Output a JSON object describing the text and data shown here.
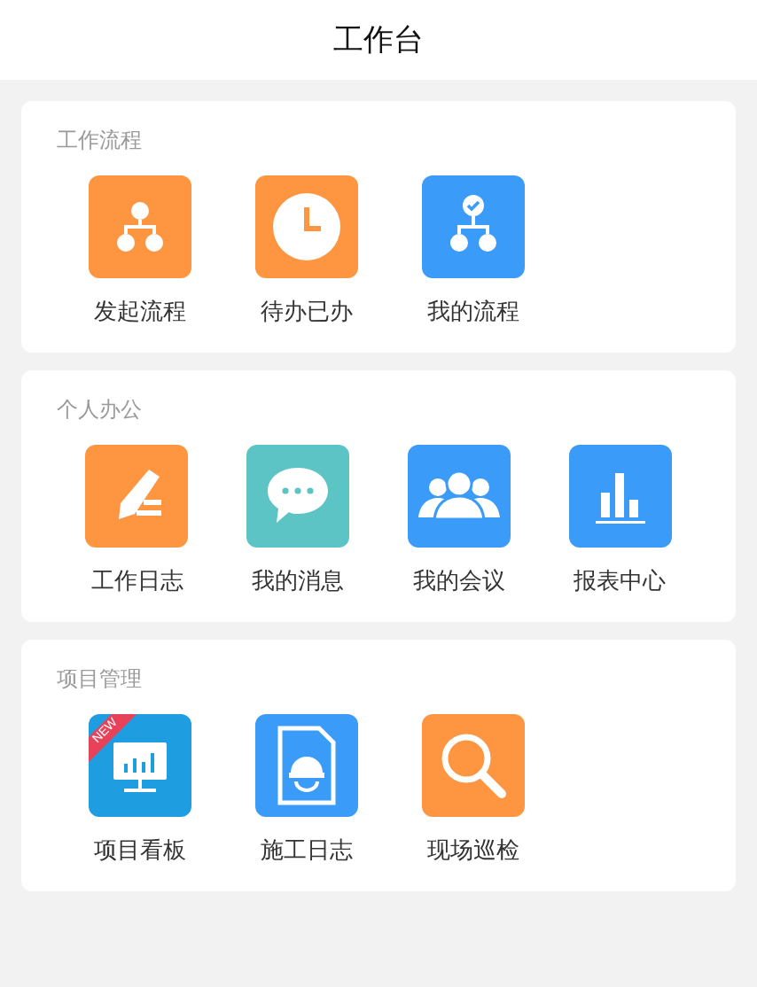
{
  "header": {
    "title": "工作台"
  },
  "sections": [
    {
      "title": "工作流程",
      "items": [
        {
          "label": "发起流程",
          "kind": "flow",
          "color": "#fe9540"
        },
        {
          "label": "待办已办",
          "kind": "clock",
          "color": "#fe9540"
        },
        {
          "label": "我的流程",
          "kind": "flowcheck",
          "color": "#3a9bf8"
        }
      ]
    },
    {
      "title": "个人办公",
      "items": [
        {
          "label": "工作日志",
          "kind": "pencil",
          "color": "#fe9540"
        },
        {
          "label": "我的消息",
          "kind": "chat",
          "color": "#5cc4c4"
        },
        {
          "label": "我的会议",
          "kind": "people",
          "color": "#3a9bf8"
        },
        {
          "label": "报表中心",
          "kind": "bars",
          "color": "#3a9bf8"
        }
      ]
    },
    {
      "title": "项目管理",
      "items": [
        {
          "label": "项目看板",
          "kind": "monitor",
          "color": "#1e9ee0",
          "badge": "NEW"
        },
        {
          "label": "施工日志",
          "kind": "helmetdoc",
          "color": "#3a9bf8"
        },
        {
          "label": "现场巡检",
          "kind": "search",
          "color": "#fe9540"
        }
      ]
    }
  ]
}
